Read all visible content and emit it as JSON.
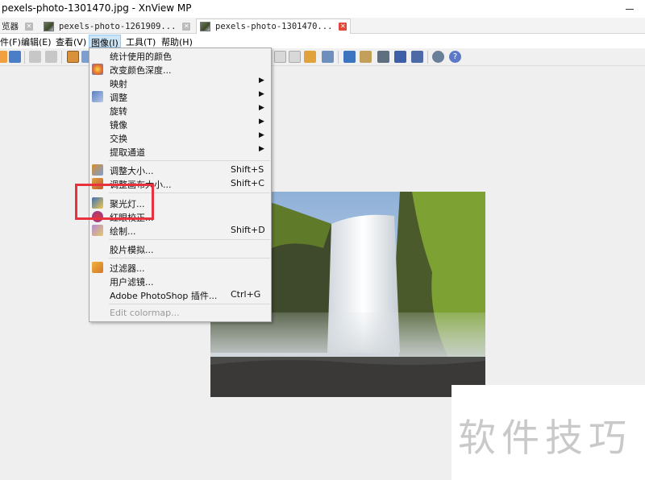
{
  "window": {
    "title": "pexels-photo-1301470.jpg - XnView MP"
  },
  "tabs": [
    {
      "label": "览器",
      "active": false
    },
    {
      "label": "pexels-photo-1261909...",
      "active": false
    },
    {
      "label": "pexels-photo-1301470...",
      "active": true
    }
  ],
  "menubar": {
    "items": [
      "件(F)",
      "编辑(E)",
      "查看(V)",
      "图像(I)",
      "工具(T)",
      "帮助(H)"
    ],
    "open_index": 3
  },
  "image_menu": {
    "items": [
      {
        "label": "统计使用的颜色",
        "shortcut": "",
        "submenu": false,
        "icon": "",
        "disabled": false
      },
      {
        "label": "改变颜色深度...",
        "shortcut": "",
        "submenu": false,
        "icon": "color-depth-icon",
        "disabled": false
      },
      {
        "label": "映射",
        "shortcut": "",
        "submenu": true,
        "icon": "",
        "disabled": false
      },
      {
        "label": "调整",
        "shortcut": "",
        "submenu": true,
        "icon": "adjust-icon",
        "disabled": false
      },
      {
        "label": "旋转",
        "shortcut": "",
        "submenu": true,
        "icon": "",
        "disabled": false
      },
      {
        "label": "镜像",
        "shortcut": "",
        "submenu": true,
        "icon": "",
        "disabled": false
      },
      {
        "label": "交换",
        "shortcut": "",
        "submenu": true,
        "icon": "",
        "disabled": false
      },
      {
        "label": "提取通道",
        "shortcut": "",
        "submenu": true,
        "icon": "",
        "disabled": false
      },
      {
        "label": "调整大小...",
        "shortcut": "Shift+S",
        "submenu": false,
        "icon": "resize-icon",
        "disabled": false
      },
      {
        "label": "调整画布大小...",
        "shortcut": "Shift+C",
        "submenu": false,
        "icon": "canvas-size-icon",
        "disabled": false
      },
      {
        "label": "聚光灯...",
        "shortcut": "",
        "submenu": false,
        "icon": "spotlight-icon",
        "disabled": false
      },
      {
        "label": "红眼校正...",
        "shortcut": "",
        "submenu": false,
        "icon": "red-eye-icon",
        "disabled": false
      },
      {
        "label": "绘制...",
        "shortcut": "Shift+D",
        "submenu": false,
        "icon": "draw-icon",
        "disabled": false
      },
      {
        "label": "胶片模拟...",
        "shortcut": "",
        "submenu": false,
        "icon": "",
        "disabled": false
      },
      {
        "label": "过滤器...",
        "shortcut": "",
        "submenu": false,
        "icon": "filter-icon",
        "disabled": false
      },
      {
        "label": "用户滤镜...",
        "shortcut": "",
        "submenu": false,
        "icon": "",
        "disabled": false
      },
      {
        "label": "Adobe PhotoShop 插件...",
        "shortcut": "Ctrl+G",
        "submenu": false,
        "icon": "",
        "disabled": false
      },
      {
        "label": "Edit colormap...",
        "shortcut": "",
        "submenu": false,
        "icon": "",
        "disabled": true
      }
    ],
    "highlighted_item": "聚光灯..."
  },
  "watermark": {
    "text": "软件技巧"
  },
  "colors": {
    "highlight_box": "#e8323d",
    "active_tab_close": "#e04a3c",
    "menu_open_bg": "#cde6f7"
  }
}
